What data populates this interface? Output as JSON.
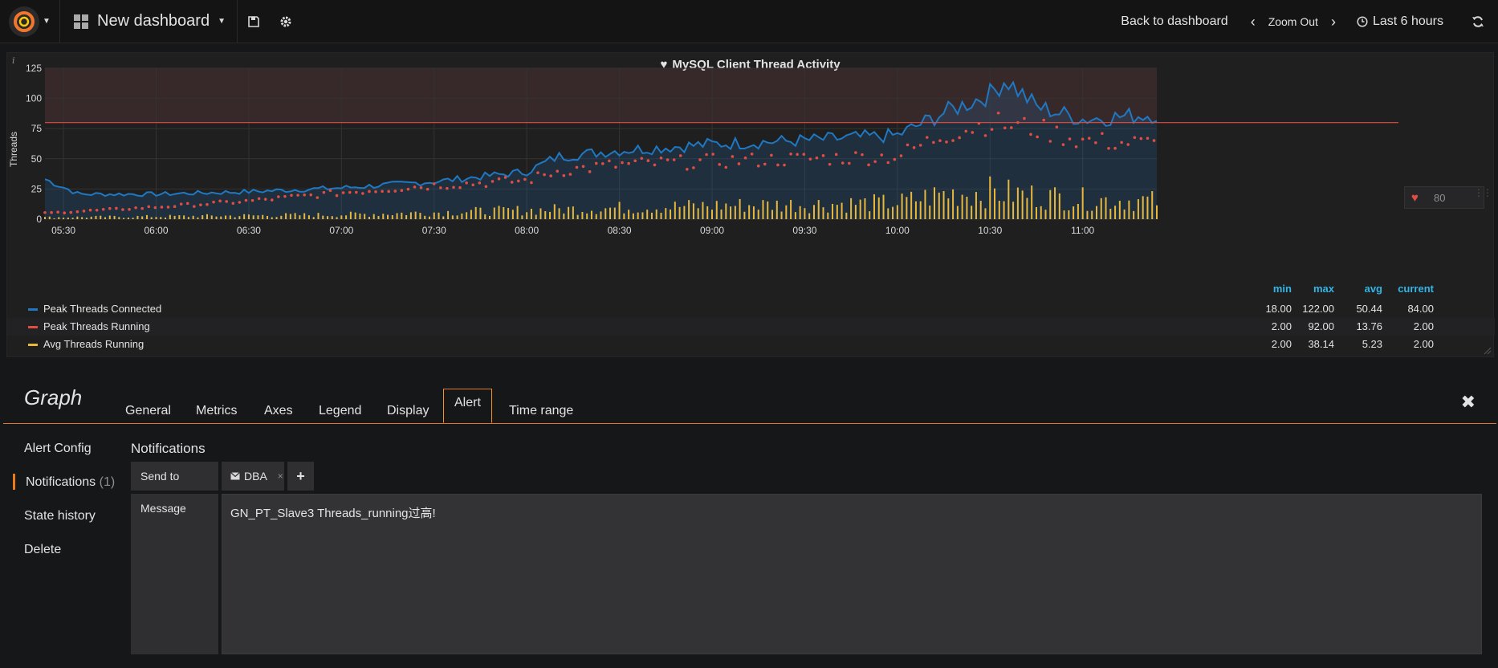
{
  "topnav": {
    "dashboard_title": "New dashboard",
    "back_to_dashboard": "Back to dashboard",
    "zoom_out": "Zoom Out",
    "time_range": "Last 6 hours"
  },
  "panel": {
    "info": "i",
    "title": "MySQL Client Thread Activity",
    "threshold_value": "80"
  },
  "chart_data": {
    "type": "line",
    "title": "MySQL Client Thread Activity",
    "ylabel": "Threads",
    "xlabel": "",
    "ylim": [
      0,
      125
    ],
    "y_ticks": [
      "0",
      "25",
      "50",
      "75",
      "100",
      "125"
    ],
    "x_ticks": [
      "05:30",
      "06:00",
      "06:30",
      "07:00",
      "07:30",
      "08:00",
      "08:30",
      "09:00",
      "09:30",
      "10:00",
      "10:30",
      "11:00"
    ],
    "x_range": [
      "05:24",
      "11:24"
    ],
    "threshold": 80,
    "threshold_color": "#e24d42",
    "grid": true,
    "series": [
      {
        "name": "Peak Threads Connected",
        "color": "#1f78c1",
        "style": "line-area",
        "keypoints": [
          [
            "05:24",
            32
          ],
          [
            "05:35",
            20
          ],
          [
            "06:00",
            20
          ],
          [
            "06:30",
            22
          ],
          [
            "07:00",
            25
          ],
          [
            "07:30",
            30
          ],
          [
            "08:00",
            38
          ],
          [
            "08:10",
            50
          ],
          [
            "08:30",
            55
          ],
          [
            "09:00",
            60
          ],
          [
            "09:30",
            63
          ],
          [
            "10:00",
            67
          ],
          [
            "10:15",
            85
          ],
          [
            "10:30",
            100
          ],
          [
            "10:35",
            112
          ],
          [
            "10:45",
            90
          ],
          [
            "11:00",
            80
          ],
          [
            "11:24",
            84
          ]
        ]
      },
      {
        "name": "Peak Threads Running",
        "color": "#e24d42",
        "style": "points",
        "keypoints": [
          [
            "05:24",
            5
          ],
          [
            "06:00",
            10
          ],
          [
            "06:30",
            15
          ],
          [
            "07:00",
            22
          ],
          [
            "07:30",
            28
          ],
          [
            "08:00",
            32
          ],
          [
            "08:10",
            40
          ],
          [
            "08:30",
            45
          ],
          [
            "09:00",
            48
          ],
          [
            "09:30",
            50
          ],
          [
            "10:00",
            52
          ],
          [
            "10:15",
            70
          ],
          [
            "10:30",
            80
          ],
          [
            "10:45",
            75
          ],
          [
            "11:00",
            65
          ],
          [
            "11:24",
            62
          ]
        ]
      },
      {
        "name": "Avg Threads Running",
        "color": "#eab839",
        "style": "bars",
        "keypoints": [
          [
            "05:24",
            2
          ],
          [
            "06:00",
            3
          ],
          [
            "07:00",
            5
          ],
          [
            "08:00",
            10
          ],
          [
            "09:00",
            15
          ],
          [
            "10:00",
            18
          ],
          [
            "10:15",
            28
          ],
          [
            "10:30",
            30
          ],
          [
            "11:00",
            22
          ],
          [
            "11:24",
            20
          ]
        ]
      }
    ]
  },
  "legend": {
    "headers": [
      "min",
      "max",
      "avg",
      "current"
    ],
    "rows": [
      {
        "name": "Peak Threads Connected",
        "color": "#1f78c1",
        "min": "18.00",
        "max": "122.00",
        "avg": "50.44",
        "current": "84.00"
      },
      {
        "name": "Peak Threads Running",
        "color": "#e24d42",
        "min": "2.00",
        "max": "92.00",
        "avg": "13.76",
        "current": "2.00"
      },
      {
        "name": "Avg Threads Running",
        "color": "#eab839",
        "min": "2.00",
        "max": "38.14",
        "avg": "5.23",
        "current": "2.00"
      }
    ]
  },
  "editor": {
    "title": "Graph",
    "tabs": [
      "General",
      "Metrics",
      "Axes",
      "Legend",
      "Display",
      "Alert",
      "Time range"
    ],
    "active_tab": "Alert",
    "close": "✖"
  },
  "sidebar": {
    "items": [
      {
        "label": "Alert Config"
      },
      {
        "label": "Notifications",
        "count": "(1)"
      },
      {
        "label": "State history"
      },
      {
        "label": "Delete"
      }
    ]
  },
  "notifications": {
    "title": "Notifications",
    "send_to_label": "Send to",
    "chip_label": "DBA",
    "chip_remove": "×",
    "add": "+",
    "message_label": "Message",
    "message_value": "GN_PT_Slave3 Threads_running过高!"
  }
}
